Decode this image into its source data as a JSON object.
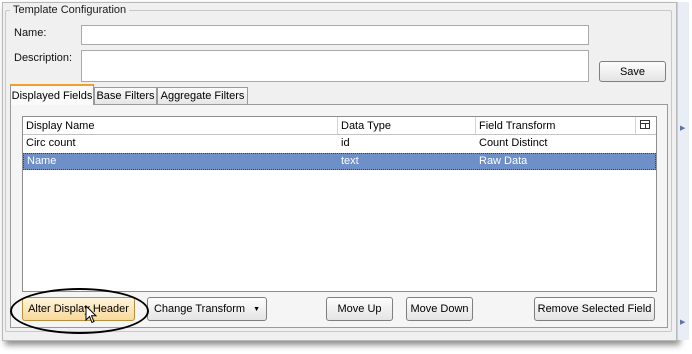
{
  "group": {
    "title": "Template Configuration"
  },
  "form": {
    "name_label": "Name:",
    "name_value": "",
    "description_label": "Description:",
    "description_value": "",
    "save_label": "Save"
  },
  "tabs": [
    {
      "label": "Displayed Fields",
      "active": true
    },
    {
      "label": "Base Filters",
      "active": false
    },
    {
      "label": "Aggregate Filters",
      "active": false
    }
  ],
  "table": {
    "columns": [
      "Display Name",
      "Data Type",
      "Field Transform"
    ],
    "column_chooser_icon": "column-chooser-icon",
    "rows": [
      {
        "display_name": "Circ count",
        "data_type": "id",
        "field_transform": "Count Distinct",
        "selected": false
      },
      {
        "display_name": "Name",
        "data_type": "text",
        "field_transform": "Raw Data",
        "selected": true
      }
    ]
  },
  "actions": {
    "alter_display_header": "Alter Display Header",
    "change_transform": "Change Transform",
    "change_transform_icon": "dropdown-arrow-icon",
    "move_up": "Move Up",
    "move_down": "Move Down",
    "remove_selected_field": "Remove Selected Field"
  },
  "annotation": {
    "shape": "ellipse-callout",
    "color": "#000000"
  },
  "colors": {
    "selection": "#6e8fc7",
    "active_tab_accent": "#f0a030",
    "highlight_button": "#f7d99a"
  }
}
